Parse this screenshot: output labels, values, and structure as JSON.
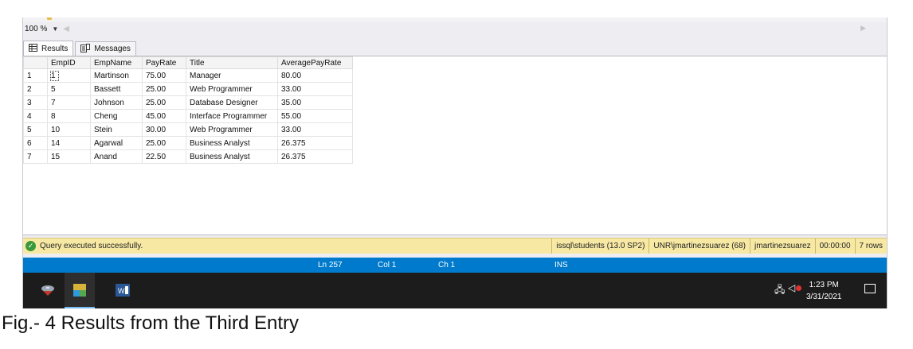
{
  "zoom": {
    "value": "100 %"
  },
  "tabs": {
    "results": "Results",
    "messages": "Messages"
  },
  "grid": {
    "columns": [
      "EmpID",
      "EmpName",
      "PayRate",
      "Title",
      "AveragePayRate"
    ],
    "rows": [
      {
        "num": "1",
        "cells": [
          "1",
          "Martinson",
          "75.00",
          "Manager",
          "80.00"
        ]
      },
      {
        "num": "2",
        "cells": [
          "5",
          "Bassett",
          "25.00",
          "Web Programmer",
          "33.00"
        ]
      },
      {
        "num": "3",
        "cells": [
          "7",
          "Johnson",
          "25.00",
          "Database Designer",
          "35.00"
        ]
      },
      {
        "num": "4",
        "cells": [
          "8",
          "Cheng",
          "45.00",
          "Interface Programmer",
          "55.00"
        ]
      },
      {
        "num": "5",
        "cells": [
          "10",
          "Stein",
          "30.00",
          "Web Programmer",
          "33.00"
        ]
      },
      {
        "num": "6",
        "cells": [
          "14",
          "Agarwal",
          "25.00",
          "Business Analyst",
          "26.375"
        ]
      },
      {
        "num": "7",
        "cells": [
          "15",
          "Anand",
          "22.50",
          "Business Analyst",
          "26.375"
        ]
      }
    ]
  },
  "status": {
    "message": "Query executed successfully.",
    "server": "issql\\students (13.0 SP2)",
    "login": "UNR\\jmartinezsuarez (68)",
    "database": "jmartinezsuarez",
    "elapsed": "00:00:00",
    "rows": "7 rows",
    "color": "#f7e9a4"
  },
  "editor_status": {
    "ln": "Ln 257",
    "col": "Col 1",
    "ch": "Ch 1",
    "mode": "INS",
    "color": "#007acc"
  },
  "taskbar": {
    "time": "1:23 PM",
    "date": "3/31/2021",
    "icons": [
      "ssms-app-icon",
      "visual-studio-icon",
      "word-icon",
      "network-icon",
      "volume-muted-icon",
      "notification-icon"
    ]
  },
  "caption": "Fig.- 4 Results from the Third Entry"
}
